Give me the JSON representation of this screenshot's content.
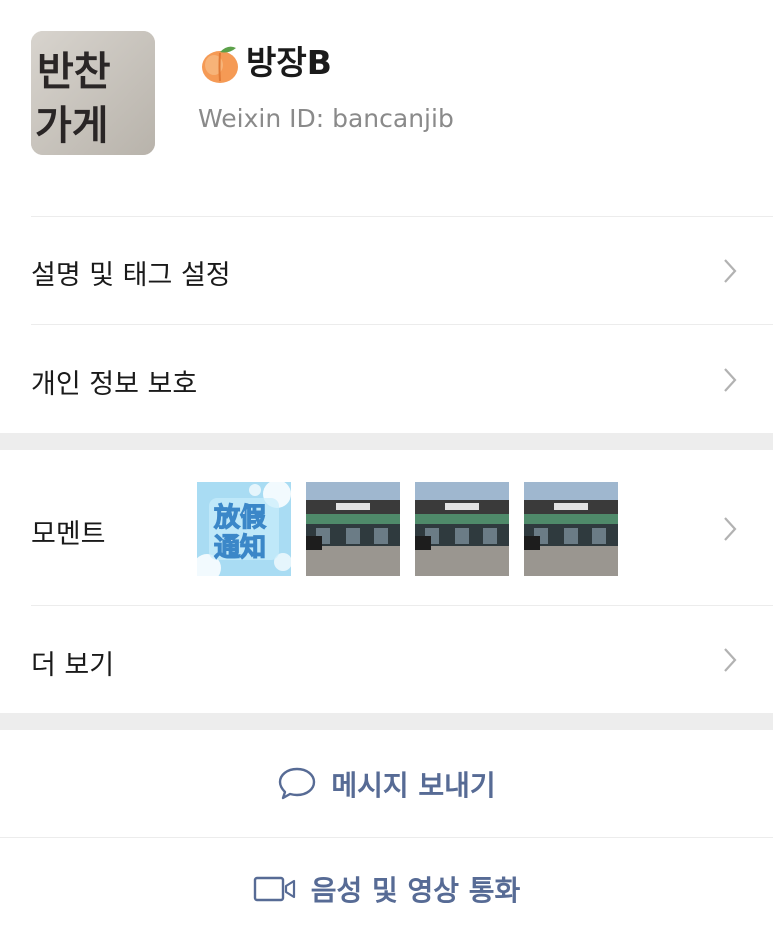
{
  "profile": {
    "avatar_text_line1": "반찬",
    "avatar_text_line2": "가게",
    "nickname": "방장B",
    "nickname_emoji_icon": "peach-icon",
    "weixin_id": "Weixin ID: bancanjib"
  },
  "menu": {
    "remarks_tags": "설명 및 태그 설정",
    "privacy": "개인 정보 보호",
    "moments": "모멘트",
    "more": "더 보기"
  },
  "moments_thumbs": [
    {
      "type": "notice-graphic",
      "text_line1": "放假",
      "text_line2": "通知"
    },
    {
      "type": "storefront-photo"
    },
    {
      "type": "storefront-photo"
    },
    {
      "type": "storefront-photo"
    }
  ],
  "actions": {
    "send_message": "메시지 보내기",
    "send_message_icon": "chat-bubble-icon",
    "voice_video_call": "음성 및 영상 통화",
    "voice_video_call_icon": "video-camera-icon"
  },
  "colors": {
    "action_blue": "#576b95",
    "section_gap": "#ededed",
    "divider": "#ececec"
  }
}
